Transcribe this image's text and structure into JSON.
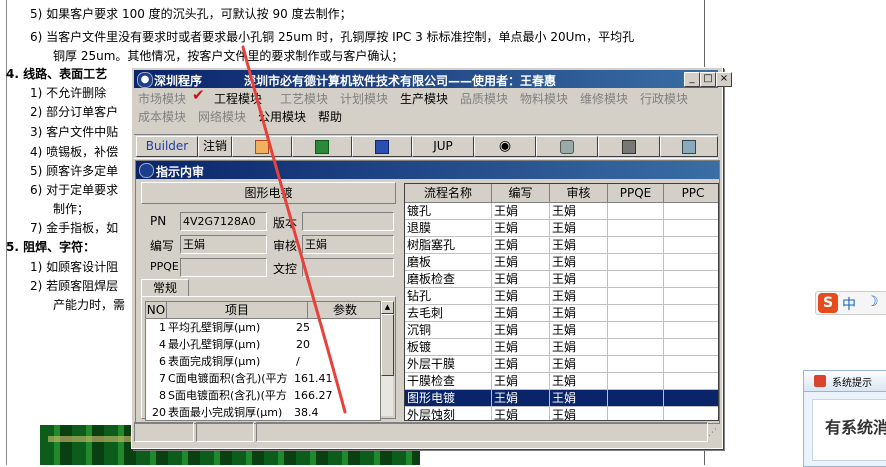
{
  "document": {
    "lines": [
      {
        "text": "5)  如果客户要求 100 度的沉头孔，可默认按 90 度去制作；",
        "bold": false
      },
      {
        "text": "6)  当客户文件里没有要求时或者要求最小孔铜 25um 时，孔铜厚按 IPC 3 标标准控制，单点最小 20Um，平均孔",
        "bold": false
      },
      {
        "text": "铜厚 25um。其他情况，按客户文件里的要求制作或与客户确认；",
        "bold": false
      },
      {
        "text": "4.   线路、表面工艺",
        "bold": true
      },
      {
        "text": "1)  不允许删除",
        "bold": false
      },
      {
        "text": "2)  部分订单客户",
        "bold": false
      },
      {
        "text": "3)  客户文件中贴",
        "bold": false
      },
      {
        "text": "4)  喷锡板，补偿",
        "bold": false
      },
      {
        "text": "5)  顾客许多定单",
        "bold": false
      },
      {
        "text": "6)  对于定单要求",
        "bold": false
      },
      {
        "text": "制作；",
        "bold": false
      },
      {
        "text": "7)  金手指板，如",
        "bold": false
      },
      {
        "text": "5.   阻焊、字符：",
        "bold": true
      },
      {
        "text": "1)  如顾客设计阻",
        "bold": false
      },
      {
        "text": "2)  若顾客阻焊层",
        "bold": false
      },
      {
        "text": "产能力时，需",
        "bold": false
      }
    ]
  },
  "tray": {
    "sogou_s": "S",
    "sogou_lang": "中",
    "sogou_moon": "☽",
    "notice_title": "系统提示",
    "notice_text": "有系统消"
  },
  "window": {
    "title": "深圳程序",
    "company": "深圳市必有德计算机软件技术有限公司——使用者：王春惠",
    "buttons": {
      "minimize": "_",
      "maximize": "□",
      "close": "×"
    },
    "menu_row1": [
      {
        "label": "市场模块",
        "active": false
      },
      {
        "label": "工程模块",
        "active": true
      },
      {
        "label": "工艺模块",
        "active": false
      },
      {
        "label": "计划模块",
        "active": false
      },
      {
        "label": "生产模块",
        "active": true
      },
      {
        "label": "品质模块",
        "active": false
      },
      {
        "label": "物料模块",
        "active": false
      },
      {
        "label": "维修模块",
        "active": false
      },
      {
        "label": "行政模块",
        "active": false
      }
    ],
    "menu_row2": [
      {
        "label": "成本模块",
        "active": false
      },
      {
        "label": "网络模块",
        "active": false
      },
      {
        "label": "公用模块",
        "active": true
      },
      {
        "label": "帮助",
        "active": true
      }
    ],
    "toolbar": {
      "builder": "Builder",
      "logout": "注销",
      "jup": "JUP"
    }
  },
  "inner": {
    "title": "指示内审",
    "section_title": "图形电镀",
    "fields": {
      "pn_label": "PN",
      "pn_value": "4V2G7128A0",
      "version_label": "版本",
      "version_value": "",
      "author_label": "编写",
      "author_value": "王娟",
      "review_label": "审核",
      "review_value": "王娟",
      "ppqe_label": "PPQE",
      "ppqe_value": "",
      "doc_label": "文控",
      "doc_value": ""
    },
    "tab": "常规",
    "param_headers": [
      "NO",
      "项目",
      "参数"
    ],
    "params": [
      {
        "no": "1",
        "item": "平均孔壁铜厚(μm)",
        "value": "25"
      },
      {
        "no": "4",
        "item": "最小孔壁铜厚(μm)",
        "value": "20"
      },
      {
        "no": "6",
        "item": "表面完成铜厚(μm)",
        "value": "/"
      },
      {
        "no": "7",
        "item": "C面电镀面积(含孔)(平方",
        "value": "161.41"
      },
      {
        "no": "8",
        "item": "S面电镀面积(含孔)(平方",
        "value": "166.27"
      },
      {
        "no": "20",
        "item": "表面最小完成铜厚(μm)",
        "value": "38.4"
      }
    ],
    "process_headers": [
      "流程名称",
      "编写",
      "审核",
      "PPQE",
      "PPC"
    ],
    "process_rows": [
      {
        "name": "镀孔",
        "author": "王娟",
        "review": "王娟",
        "selected": false
      },
      {
        "name": "退膜",
        "author": "王娟",
        "review": "王娟",
        "selected": false
      },
      {
        "name": "树脂塞孔",
        "author": "王娟",
        "review": "王娟",
        "selected": false
      },
      {
        "name": "磨板",
        "author": "王娟",
        "review": "王娟",
        "selected": false
      },
      {
        "name": "磨板检查",
        "author": "王娟",
        "review": "王娟",
        "selected": false
      },
      {
        "name": "钻孔",
        "author": "王娟",
        "review": "王娟",
        "selected": false
      },
      {
        "name": "去毛刺",
        "author": "王娟",
        "review": "王娟",
        "selected": false
      },
      {
        "name": "沉铜",
        "author": "王娟",
        "review": "王娟",
        "selected": false
      },
      {
        "name": "板镀",
        "author": "王娟",
        "review": "王娟",
        "selected": false
      },
      {
        "name": "外层干膜",
        "author": "王娟",
        "review": "王娟",
        "selected": false
      },
      {
        "name": "干膜检查",
        "author": "王娟",
        "review": "王娟",
        "selected": false
      },
      {
        "name": "图形电镀",
        "author": "王娟",
        "review": "王娟",
        "selected": true
      },
      {
        "name": "外层蚀刻",
        "author": "王娟",
        "review": "王娟",
        "selected": false
      }
    ]
  }
}
